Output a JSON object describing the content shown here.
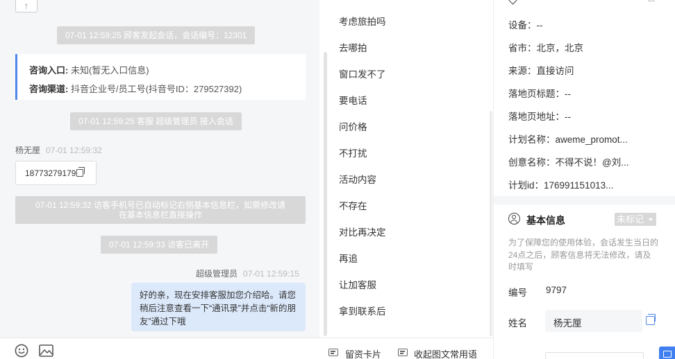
{
  "chat": {
    "system_messages": {
      "session_start": "07-01 12:59:25 顾客发起会话，会话编号：12301",
      "agent_join": "07-01 12:59:25 客服 超级管理员 接入会话",
      "phone_marked_line1": "07-01 12:59:32 访客手机号已自动标记右侧基本信息栏，如需修改请",
      "phone_marked_line2": "在基本信息栏直接操作",
      "visitor_left": "07-01 12:59:33 访客已离开"
    },
    "consult_card": {
      "entry_label": "咨询入口:",
      "entry_value": "未知(暂无入口信息)",
      "channel_label": "咨询渠道:",
      "channel_value": "抖音企业号/员工号(抖音号ID：279527392)"
    },
    "visitor_message": {
      "sender": "杨无厘",
      "time": "07-01 12:59:32",
      "text": "18773279179"
    },
    "agent_message": {
      "sender": "超级管理员",
      "time": "07-01 12:59:15",
      "text": "好的亲，现在安排客服加您介绍哈。请您稍后注意查看一下“通讯录”并点击“新的朋友”通过下哦"
    },
    "top_button": "↑"
  },
  "quick_phrases": {
    "items": [
      "考虑旅拍吗",
      "去哪拍",
      "窗口发不了",
      "要电话",
      "问价格",
      "不打扰",
      "活动内容",
      "不存在",
      "对比再决定",
      "再追",
      "让加客服",
      "拿到联系后"
    ]
  },
  "toolbar": {
    "emoji_icon": "smiley-icon",
    "image_icon": "image-icon",
    "leave_card": "留资卡片",
    "collapse_phrases": "收起图文常用语"
  },
  "info_panel": {
    "device": "设备：--",
    "province_city": "省市：北京，北京",
    "source": "来源：直接访问",
    "landing_title": "落地页标题：--",
    "landing_url": "落地页地址：--",
    "plan_name": "计划名称：aweme_promot...",
    "creative_name": "创意名称：不得不说！@刘...",
    "plan_id": "计划id：176991151013...",
    "basic_info_title": "基本信息",
    "mark_status": "未标记",
    "notice": "为了保障您的使用体验，会话发生当日的24点之后，顾客信息将无法修改，请及时填写",
    "id_label": "编号",
    "id_value": "9797",
    "name_label": "姓名",
    "name_value": "杨无厘"
  },
  "colors": {
    "accent": "#4f87ec",
    "system_pill": "#d8d8d8",
    "agent_bubble": "#dce9fb",
    "chat_background": "#f5f6f8"
  }
}
